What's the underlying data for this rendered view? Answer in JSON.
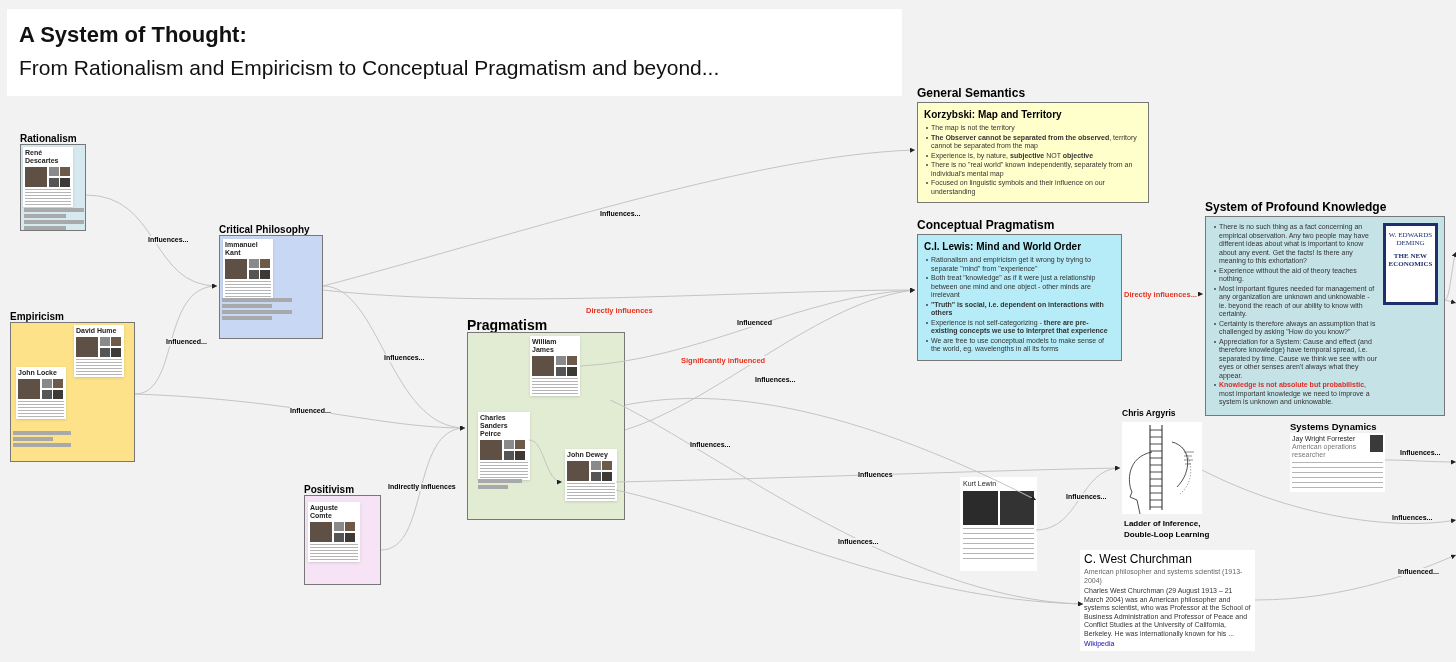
{
  "title": {
    "heading": "A System of Thought:",
    "subtitle": "From Rationalism and Empiricism to Conceptual Pragmatism and beyond..."
  },
  "groups": [
    {
      "label": "Rationalism",
      "color": "#d5e9ee",
      "cards": [
        {
          "name": "René Descartes"
        }
      ]
    },
    {
      "label": "Critical Philosophy",
      "color": "#c8d7f3",
      "cards": [
        {
          "name": "Immanuel Kant"
        }
      ]
    },
    {
      "label": "Empiricism",
      "color": "#fde289",
      "cards": [
        {
          "name": "David Hume"
        },
        {
          "name": "John Locke"
        }
      ]
    },
    {
      "label": "Pragmatism",
      "color": "#e1ecd3",
      "cards": [
        {
          "name": "William James"
        },
        {
          "name": "Charles Sanders Peirce"
        },
        {
          "name": "John Dewey"
        }
      ]
    },
    {
      "label": "Positivism",
      "color": "#f7e3f6",
      "cards": [
        {
          "name": "Auguste Comte"
        }
      ]
    }
  ],
  "notes": [
    {
      "label": "General Semantics",
      "color": "#ffffcc",
      "heading": "Korzybski: Map and Territory",
      "bullets": [
        {
          "text": "The map is not the territory",
          "bold": false
        },
        {
          "text": "**The Observer cannot be separated from the observed**, territory cannot be separated from the map",
          "bold": false
        },
        {
          "text": "Experience is, by nature, **subjective** NOT **objective**",
          "bold": false
        },
        {
          "text": "There is no \"real world\" known independently, separately from an individual's mental map",
          "bold": false
        },
        {
          "text": "Focused on linguistic symbols and their influence on our understanding",
          "bold": false
        }
      ]
    },
    {
      "label": "Conceptual Pragmatism",
      "color": "#b5ecf7",
      "heading": "C.I. Lewis: Mind and World Order",
      "bullets": [
        {
          "text": "Rationalism and empiricism get it wrong by trying to separate \"mind\" from \"experience\"",
          "bold": false
        },
        {
          "text": "Both treat \"knowledge\" as if it were just a relationship between one mind and one object - other minds are irrelevant",
          "bold": false
        },
        {
          "text": "\"Truth\" is social, i.e. dependent on interactions with others",
          "bold": true
        },
        {
          "text": "Experience is not self-categorizing - **there are pre-existing concepts we use to interpret that experience**",
          "bold": false
        },
        {
          "text": "We are free to use conceptual models to make sense of the world, eg. wavelengths in all its forms",
          "bold": false
        }
      ]
    },
    {
      "label": "System of Profound Knowledge",
      "color": "#c5e2e7",
      "bullets": [
        {
          "text": "There is no such thing as a fact concerning an empirical observation. Any two people may have different ideas about what is important to know about any event. Get the facts! Is there any meaning to this exhortation?",
          "bold": false
        },
        {
          "text": "Experience without the aid of theory teaches nothing.",
          "bold": false
        },
        {
          "text": "Most important figures needed for management of any organization are unknown and unknowable - ie. beyond the reach of our ability to know with certainty.",
          "bold": false
        },
        {
          "text": "Certainty is therefore always an assumption that is challenged by asking \"How do you know?\"",
          "bold": false
        },
        {
          "text": "Appreciation for a System: Cause and effect (and therefore knowledge) have temporal spread, i.e. separated by time. Cause we think we see with our eyes or other senses aren't always what they appear.",
          "bold": false
        },
        {
          "lead": "Knowledge is not absolute but probabilistic",
          "text": ", most important knowledge we need to improve a system is unknown and unknowable.",
          "bold": false
        }
      ],
      "cover": {
        "author": "W. EDWARDS DEMING",
        "title": "THE NEW ECONOMICS"
      }
    }
  ],
  "systems_dynamics": {
    "label": "Systems Dynamics",
    "name": "Jay Wright Forrester",
    "subtitle": "American operations researcher"
  },
  "argyris": {
    "label": "Chris Argyris",
    "caption": "Ladder of Inference, Double-Loop Learning"
  },
  "lewin": {
    "name": "Kurt Lewin"
  },
  "churchman": {
    "name": "C. West Churchman",
    "subtitle": "American philosopher and systems scientist (1913-2004)",
    "body": "Charles West Churchman (29 August 1913 – 21 March 2004) was an American philosopher and systems scientist, who was Professor at the School of Business Administration and Professor of Peace and Conflict Studies at the University of California, Berkeley. He was internationally known for his ...",
    "link": "Wikipedia"
  },
  "edges": [
    {
      "label": "Influences...",
      "emphasis": false
    },
    {
      "label": "Influenced...",
      "emphasis": false
    },
    {
      "label": "Influenced...",
      "emphasis": false
    },
    {
      "label": "Influences...",
      "emphasis": false
    },
    {
      "label": "Indirectly influences",
      "emphasis": false
    },
    {
      "label": "Influences...",
      "emphasis": false
    },
    {
      "label": "Directly influences",
      "emphasis": true
    },
    {
      "label": "Influenced",
      "emphasis": false
    },
    {
      "label": "Significantly influenced",
      "emphasis": true
    },
    {
      "emphasis": false
    },
    {
      "label": "Influences",
      "emphasis": false
    },
    {
      "label": "Influences...",
      "emphasis": false
    },
    {
      "label": "Influences...",
      "emphasis": false
    },
    {
      "label": "Influences...",
      "emphasis": false
    },
    {
      "label": "Directly influences...",
      "emphasis": true
    },
    {
      "label": "Influences...",
      "emphasis": false
    },
    {
      "label": "Influences...",
      "emphasis": false
    },
    {
      "label": "Influences...",
      "emphasis": false
    },
    {
      "label": "Influenced...",
      "emphasis": false
    },
    {
      "emphasis": false
    },
    {
      "emphasis": false
    }
  ]
}
